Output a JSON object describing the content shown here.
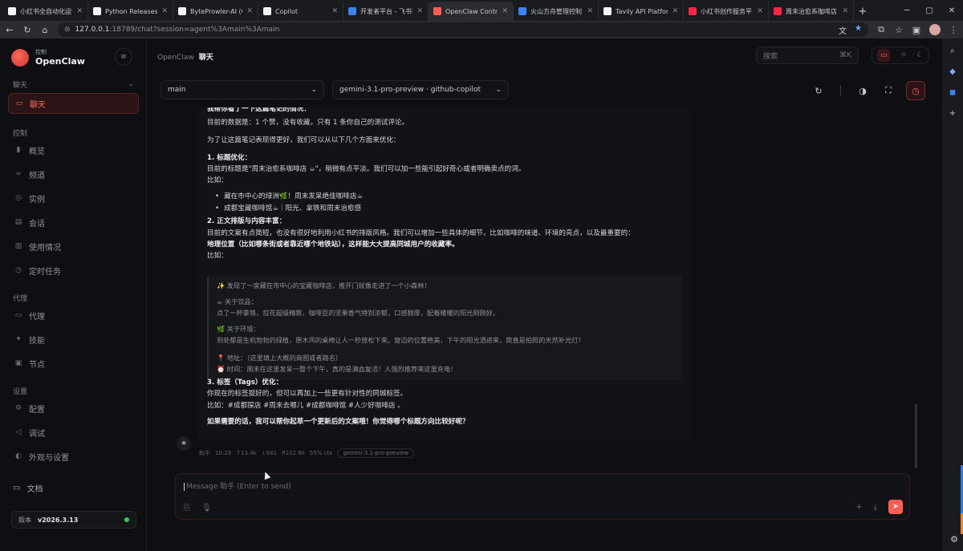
{
  "browser": {
    "tabs": [
      {
        "title": "小红书全自动化运营",
        "color": "#f2f3f5"
      },
      {
        "title": "Python Releases for",
        "color": "#f2f3f5"
      },
      {
        "title": "ByteProwler-AI (Chi",
        "color": "#f2f3f5"
      },
      {
        "title": "Copilot",
        "color": "#f2f3f5"
      },
      {
        "title": "开发者平台 - 飞书开",
        "color": "#3b82f6"
      },
      {
        "title": "OpenClaw Control",
        "color": "#ff5d52",
        "active": true
      },
      {
        "title": "火山方舟管理控制台",
        "color": "#3b82f6"
      },
      {
        "title": "Tavily API Platform",
        "color": "#f2f3f5"
      },
      {
        "title": "小红书创作服务平台",
        "color": "#ff2442"
      },
      {
        "title": "周末治愈系咖啡店",
        "color": "#ff2442"
      }
    ],
    "url_host": "127.0.0.1",
    "url_rest": ":18789/chat?session=agent%3Amain%3Amain",
    "new_tab": "+"
  },
  "sidebar": {
    "brand_small": "控制",
    "brand_name": "OpenClaw",
    "sections": [
      {
        "title": "聊天",
        "items": [
          {
            "label": "聊天",
            "icon": "chat-icon",
            "glyph": "▭",
            "active": true
          }
        ]
      },
      {
        "title": "控制",
        "items": [
          {
            "label": "概览",
            "icon": "bar-chart-icon",
            "glyph": "▮"
          },
          {
            "label": "频道",
            "icon": "link-icon",
            "glyph": "∞"
          },
          {
            "label": "实例",
            "icon": "broadcast-icon",
            "glyph": "◎"
          },
          {
            "label": "会话",
            "icon": "document-icon",
            "glyph": "▤"
          },
          {
            "label": "使用情况",
            "icon": "usage-icon",
            "glyph": "▥"
          },
          {
            "label": "定时任务",
            "icon": "clock-icon",
            "glyph": "◷"
          }
        ]
      },
      {
        "title": "代理",
        "items": [
          {
            "label": "代理",
            "icon": "folder-icon",
            "glyph": "▭"
          },
          {
            "label": "技能",
            "icon": "sparkle-icon",
            "glyph": "✦"
          },
          {
            "label": "节点",
            "icon": "monitor-icon",
            "glyph": "▣"
          }
        ]
      },
      {
        "title": "设置",
        "items": [
          {
            "label": "配置",
            "icon": "gear-icon",
            "glyph": "⚙"
          },
          {
            "label": "调试",
            "icon": "send-icon",
            "glyph": "◁"
          },
          {
            "label": "外观与设置",
            "icon": "appearance-icon",
            "glyph": "◐"
          }
        ]
      }
    ],
    "docs_label": "文档",
    "version_label": "版本",
    "version_value": "v2026.3.13"
  },
  "header": {
    "crumb_root": "OpenClaw",
    "crumb_current": "聊天",
    "search_placeholder": "搜索",
    "search_shortcut": "⌘K"
  },
  "toolbar": {
    "session_select": "main",
    "model_select": "gemini-3.1-pro-preview · github-copilot"
  },
  "message": {
    "lines": [
      {
        "t": "我帮你看了一下这篇笔记的情况：",
        "b": true
      },
      {
        "t": "目前的数据是：1 个赞，没有收藏，只有 1 条你自己的测试评论。"
      },
      {
        "t": "为了让这篇笔记表现得更好，我们可以从以下几个方面来优化："
      },
      {
        "t": "1. 标题优化：",
        "b": true
      },
      {
        "t": "目前的标题是\"周末治愈系咖啡店 ☕\"，稍微有点平淡。我们可以加一些能引起好奇心或者明确卖点的词。"
      },
      {
        "t": "比如："
      },
      {
        "t": "藏在市中心的绿洲🌿！周末发呆绝佳咖啡店☕",
        "bullet": true
      },
      {
        "t": "成都宝藏咖啡馆☕｜阳光、拿铁和周末治愈感",
        "bullet": true
      },
      {
        "t": "2. 正文排版与内容丰富：",
        "b": true
      },
      {
        "t": "目前的文案有点简短，也没有很好地利用小红书的排版风格。我们可以增加一些具体的细节，比如咖啡的味道、环境的亮点，以及最重要的："
      },
      {
        "t": "地理位置（比如哪条街或者靠近哪个地铁站），这样能大大提高同城用户的收藏率。",
        "b": true
      },
      {
        "t": "比如："
      },
      {
        "t": "3. 标签（Tags）优化：",
        "b": true
      },
      {
        "t": "你现在的标签挺好的，但可以再加上一些更有针对性的同城标签。"
      },
      {
        "t": "比如：#成都探店 #周末去哪儿 #成都咖啡馆 #人少好咖啡店 。"
      },
      {
        "t": "如果需要的话，我可以帮你起草一个更新后的文案哦！你觉得哪个标题方向比较好呢？",
        "b": true
      }
    ],
    "quote": [
      "✨ 发现了一家藏在市中心的宝藏咖啡店，推开门就像走进了一个小森林！",
      "☕ 关于饮品：",
      "点了一杯拿铁，拉花超级精致，咖啡豆的坚果香气特别浓郁，口感醇厚，配着暖暖的阳光刚刚好。",
      "🌿 关于环境：",
      "到处都是生机勃勃的绿植，原木风的桌椅让人一秒放松下来。窗边的位置绝美，下午的阳光洒进来，简直是拍照的天然补光灯！",
      "📍 地址：（这里填上大概的商圈或者路名）",
      "⏰ 时间：周末在这里发呆一整个下午，真的是满血复活！人强烈推荐来这里充电！"
    ],
    "meta": [
      "助手",
      "10:28",
      "↑13.4k",
      "↓941",
      "R102.8k",
      "55% ctx"
    ],
    "meta_chip": "gemini-3.1-pro-preview"
  },
  "composer": {
    "placeholder": "Message 助手 (Enter to send)"
  }
}
